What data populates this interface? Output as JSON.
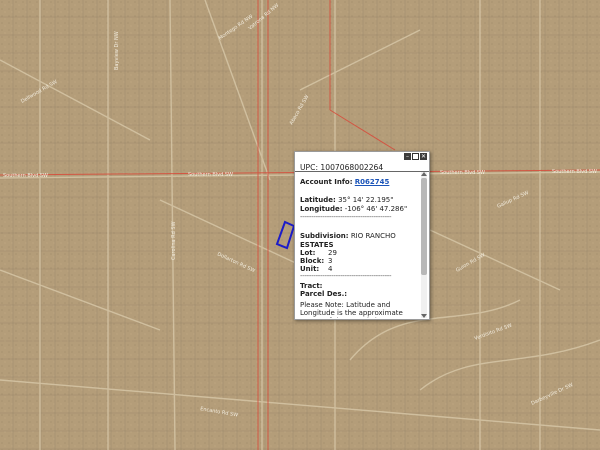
{
  "map": {
    "street_labels": [
      "Dellwood Rd SW",
      "Bayview Dr NW",
      "Montego Rd NW",
      "Vatrona Rd NW",
      "Southern Blvd SW",
      "Southern Blvd SW",
      "Southern Blvd SW",
      "Southern Blvd SW",
      "Abaco Rd SW",
      "Gallup Rd SW",
      "Carolina Rd SW",
      "Dollarton Rd SW",
      "Guion Rd SW",
      "Verdisito Rd SW",
      "Encanto Rd SW",
      "Darbeyville Dr SW"
    ],
    "parcel_outline_color": "#1c1cc8",
    "boundary_color": "#d84a3a"
  },
  "popup": {
    "title": "UPC: 1007068002264",
    "controls": [
      "minimize-icon",
      "maximize-icon",
      "close-icon"
    ],
    "account_label": "Account Info:",
    "account_link": "R062745",
    "latitude_label": "Latitude:",
    "latitude": "35° 14' 22.195\"",
    "longitude_label": "Longitude:",
    "longitude": "-106° 46' 47.286\"",
    "separator": "-----------------------------------------",
    "subdivision_label": "Subdivision:",
    "subdivision": "RIO RANCHO",
    "subdivision_cont": "ESTATES",
    "lot_label": "Lot:",
    "lot": "29",
    "block_label": "Block:",
    "block": "3",
    "unit_label": "Unit:",
    "unit": "4",
    "tract_label": "Tract:",
    "parcel_des_label": "Parcel Des.:",
    "note": "Please Note: Latitude and Longitude is the approximate center of the parcel shown."
  }
}
